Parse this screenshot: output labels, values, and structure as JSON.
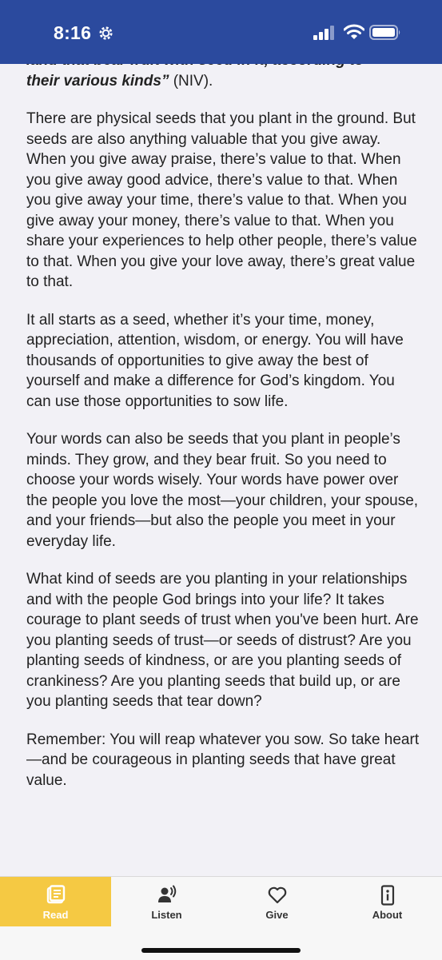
{
  "status": {
    "time": "8:16"
  },
  "article": {
    "cut_line": "land that bear fruit with seed in it, according to",
    "quote_tail": "their various kinds”",
    "quote_ref": " (NIV).",
    "paragraphs": [
      "There are physical seeds that you plant in the ground. But seeds are also anything valuable that you give away. When you give away praise, there’s value to that. When you give away good advice, there’s value to that. When you give away your time, there’s value to that. When you give away your money, there’s value to that. When you share your experiences to help other people, there’s value to that. When you give your love away, there’s great value to that.",
      "It all starts as a seed, whether it’s your time, money, appreciation, attention, wisdom, or energy. You will have thousands of opportunities to give away the best of yourself and make a difference for God’s kingdom. You can use those opportunities to sow life.",
      "Your words can also be seeds that you plant in people’s minds. They grow, and they bear fruit. So you need to choose your words wisely. Your words have power over the people you love the most—your children, your spouse, and your friends—but also the people you meet in your everyday life.",
      "What kind of seeds are you planting in your relationships and with the people God brings into your life? It takes courage to plant seeds of trust when you've been hurt. Are you planting seeds of trust—or seeds of distrust? Are you planting seeds of kindness, or are you planting seeds of crankiness? Are you planting seeds that build up, or are you planting seeds that tear down?",
      "Remember: You will reap whatever you sow. So take heart—and be courageous in planting seeds that have great value."
    ]
  },
  "tabs": [
    {
      "label": "Read",
      "icon": "book-icon",
      "active": true
    },
    {
      "label": "Listen",
      "icon": "listen-icon",
      "active": false
    },
    {
      "label": "Give",
      "icon": "heart-icon",
      "active": false
    },
    {
      "label": "About",
      "icon": "info-icon",
      "active": false
    }
  ],
  "colors": {
    "status_bar": "#2b4a9e",
    "active_tab": "#f5c943",
    "background": "#f2f1f6"
  }
}
